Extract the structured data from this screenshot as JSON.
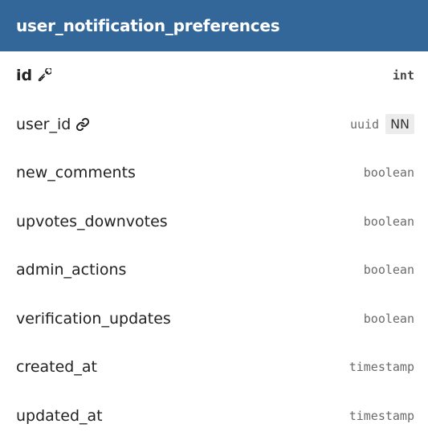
{
  "table": {
    "title": "user_notification_preferences",
    "header_color": "#336699",
    "columns": [
      {
        "name": "id",
        "type": "int",
        "primary_key": true,
        "icon": "key-icon",
        "badge": ""
      },
      {
        "name": "user_id",
        "type": "uuid",
        "primary_key": false,
        "icon": "link-icon",
        "badge": "NN"
      },
      {
        "name": "new_comments",
        "type": "boolean",
        "primary_key": false,
        "icon": "",
        "badge": ""
      },
      {
        "name": "upvotes_downvotes",
        "type": "boolean",
        "primary_key": false,
        "icon": "",
        "badge": ""
      },
      {
        "name": "admin_actions",
        "type": "boolean",
        "primary_key": false,
        "icon": "",
        "badge": ""
      },
      {
        "name": "verification_updates",
        "type": "boolean",
        "primary_key": false,
        "icon": "",
        "badge": ""
      },
      {
        "name": "created_at",
        "type": "timestamp",
        "primary_key": false,
        "icon": "",
        "badge": ""
      },
      {
        "name": "updated_at",
        "type": "timestamp",
        "primary_key": false,
        "icon": "",
        "badge": ""
      }
    ]
  }
}
